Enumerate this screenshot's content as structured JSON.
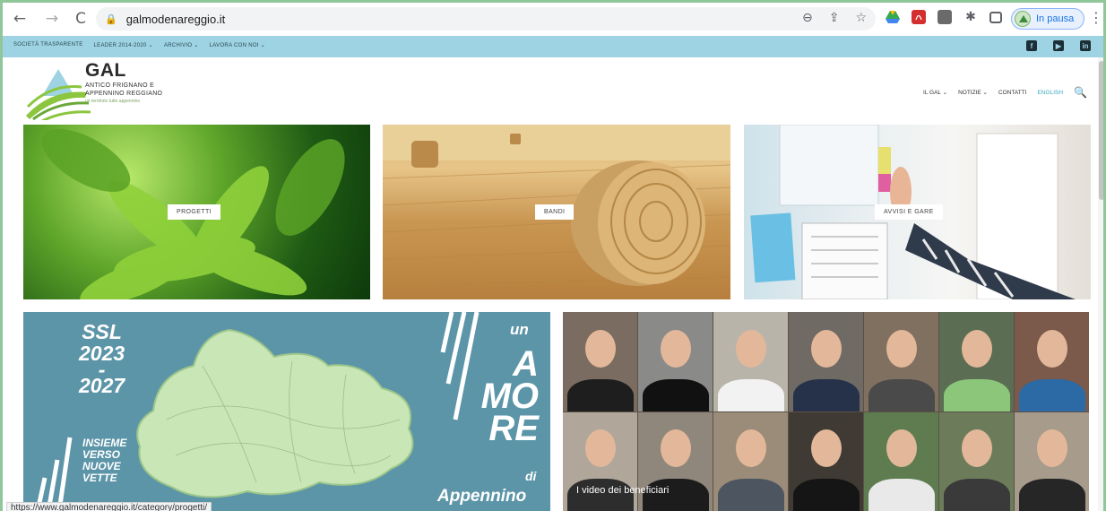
{
  "browser": {
    "back_icon": "←",
    "forward_icon": "→",
    "reload_icon": "C",
    "lock_icon": "🔒",
    "url": "galmodenareggio.it",
    "zoom_icon": "⊖",
    "share_icon": "⇪",
    "star_icon": "☆",
    "profile_label": "In pausa",
    "menu_icon": "⋮",
    "status_url": "https://www.galmodenareggio.it/category/progetti/"
  },
  "topbar": {
    "links": [
      "SOCIETÀ TRASPARENTE",
      "LEADER 2014-2020 ⌄",
      "ARCHIVIO ⌄",
      "LAVORA CON NOI ⌄"
    ],
    "social": [
      "f",
      "▶",
      "in"
    ]
  },
  "logo": {
    "title": "GAL",
    "line1": "ANTICO FRIGNANO E",
    "line2": "APPENNINO REGGIANO",
    "tagline": "un territorio tutto appennino"
  },
  "nav": {
    "items": [
      "IL GAL ⌄",
      "NOTIZIE ⌄",
      "CONTATTI",
      "ENGLISH"
    ],
    "search_icon": "🔍"
  },
  "tiles": {
    "progetti": "PROGETTI",
    "bandi": "BANDI",
    "avvisi": "AVVISI E GARE"
  },
  "ssl_banner": {
    "line1": "SSL",
    "line2": "2023",
    "line3": "-",
    "line4": "2027",
    "slogan": [
      "INSIEME",
      "VERSO",
      "NUOVE",
      "VETTE"
    ],
    "un": "un",
    "amore": [
      "A",
      "MO",
      "RE"
    ],
    "di": "di",
    "appennino": "Appennino"
  },
  "video_banner": {
    "label": "I video dei beneficiari"
  },
  "colors": {
    "topbar": "#9dd3e3",
    "banner": "#5c95a8",
    "accent": "#3aa6c0"
  }
}
